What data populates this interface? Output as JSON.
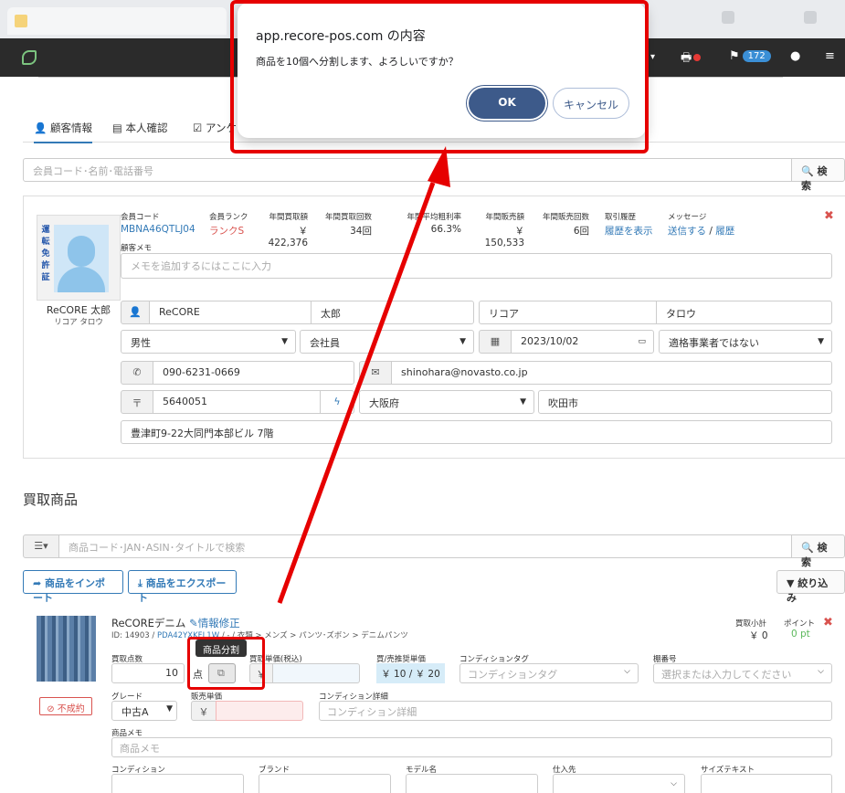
{
  "navbar": {
    "badge_count": "172"
  },
  "dialog": {
    "title": "app.recore-pos.com の内容",
    "message": "商品を10個へ分割します、よろしいですか？",
    "ok_label": "OK",
    "cancel_label": "キャンセル"
  },
  "tabs": [
    "顧客情報",
    "本人確認",
    "アンケ"
  ],
  "customer_search": {
    "placeholder": "会員コード･名前･電話番号",
    "button_label": "検索"
  },
  "customer": {
    "name": "ReCORE 太郎",
    "kana": "リコア タロウ",
    "license_text": "運転免許証",
    "stats": [
      {
        "label": "会員コード",
        "value": "MBNA46QTLJ04"
      },
      {
        "label": "会員ランク",
        "value": "ランクS"
      },
      {
        "label": "年間買取額",
        "value": "￥ 422,376"
      },
      {
        "label": "年間買取回数",
        "value": "34回"
      },
      {
        "label": "年間平均粗利率",
        "value": "66.3%"
      },
      {
        "label": "年間販売額",
        "value": "￥ 150,533"
      },
      {
        "label": "年間販売回数",
        "value": "6回"
      },
      {
        "label": "取引履歴",
        "value": "履歴を表示"
      },
      {
        "label": "メッセージ",
        "value_a": "送信する",
        "sep": "/",
        "value_b": "履歴"
      }
    ],
    "memo_label": "顧客メモ",
    "memo_placeholder": "メモを追加するにはここに入力",
    "last_name": "ReCORE",
    "first_name": "太郎",
    "last_kana": "リコア",
    "first_kana": "タロウ",
    "gender": "男性",
    "occupation": "会社員",
    "date": "2023/10/02",
    "tax_status": "適格事業者ではない",
    "phone": "090-6231-0669",
    "email": "shinohara@novasto.co.jp",
    "postal": "5640051",
    "prefecture": "大阪府",
    "city": "吹田市",
    "address": "豊津町9-22大同門本部ビル 7階"
  },
  "section_title": "買取商品",
  "product_search": {
    "placeholder": "商品コード･JAN･ASIN･タイトルで検索",
    "button_label": "検索"
  },
  "buttons": {
    "import": "商品をインポート",
    "export": "商品をエクスポート",
    "filter": "絞り込み"
  },
  "product": {
    "title": "ReCOREデニム",
    "edit_link": "情報修正",
    "id_prefix": "ID: 14903 /",
    "id_code": "PDA42YXKFL1W",
    "breadcrumb": "/ - / 衣類 > メンズ > パンツ･ズボン > デニムパンツ",
    "subtotal_label": "買取小計",
    "subtotal_value": "￥ 0",
    "points_label": "ポイント",
    "points_value": "0 pt",
    "qty_label": "買取点数",
    "qty_value": "10",
    "qty_unit": "点",
    "split_tooltip": "商品分割",
    "unit_price_label": "買取単価(税込)",
    "yen": "￥",
    "recommended_label": "買/売推奨単価",
    "recommended_value": "￥ 10 / ￥ 20",
    "condition_tag_label": "コンディションタグ",
    "condition_tag_placeholder": "コンディションタグ",
    "shelf_label": "棚番号",
    "shelf_placeholder": "選択または入力してください",
    "grade_label": "グレード",
    "grade_value": "中古A",
    "sale_price_label": "販売単価",
    "condition_detail_label": "コンディション詳細",
    "condition_detail_placeholder": "コンディション詳細",
    "status": "不成約",
    "memo_label": "商品メモ",
    "memo_placeholder": "商品メモ",
    "bottom_labels": [
      "コンディション",
      "ブランド",
      "モデル名",
      "仕入先",
      "サイズテキスト"
    ]
  }
}
